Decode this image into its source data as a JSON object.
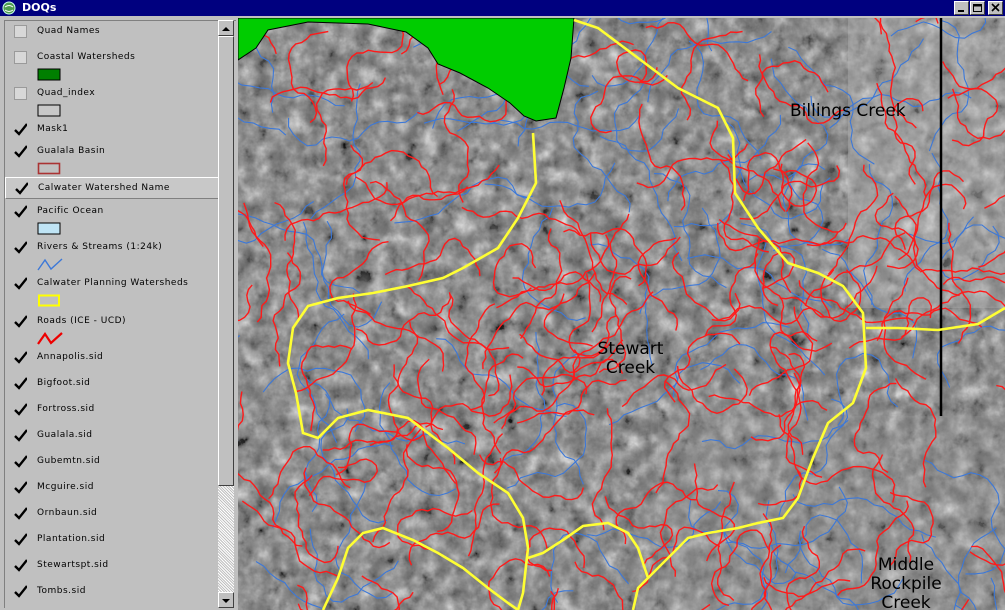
{
  "window": {
    "title": "DOQs"
  },
  "toc": {
    "layers": [
      {
        "label": "Quad Names",
        "checked": false,
        "symbol": null
      },
      {
        "label": "Coastal Watersheds",
        "checked": false,
        "symbol": "fill-green"
      },
      {
        "label": "Quad_index",
        "checked": false,
        "symbol": "fill-gray"
      },
      {
        "label": "Mask1",
        "checked": true,
        "symbol": null
      },
      {
        "label": "Gualala Basin",
        "checked": true,
        "symbol": "outline-brown"
      },
      {
        "label": "Calwater Watershed Name",
        "checked": true,
        "symbol": null,
        "selected": true
      },
      {
        "label": "Pacific Ocean",
        "checked": true,
        "symbol": "fill-lightblue"
      },
      {
        "label": "Rivers & Streams (1:24k)",
        "checked": true,
        "symbol": "line-blue"
      },
      {
        "label": "Calwater Planning Watersheds",
        "checked": true,
        "symbol": "outline-yellow"
      },
      {
        "label": "Roads (ICE - UCD)",
        "checked": true,
        "symbol": "line-red"
      },
      {
        "label": "Annapolis.sid",
        "checked": true,
        "symbol": null
      },
      {
        "label": "Bigfoot.sid",
        "checked": true,
        "symbol": null
      },
      {
        "label": "Fortross.sid",
        "checked": true,
        "symbol": null
      },
      {
        "label": "Gualala.sid",
        "checked": true,
        "symbol": null
      },
      {
        "label": "Gubemtn.sid",
        "checked": true,
        "symbol": null
      },
      {
        "label": "Mcguire.sid",
        "checked": true,
        "symbol": null
      },
      {
        "label": "Ornbaun.sid",
        "checked": true,
        "symbol": null
      },
      {
        "label": "Plantation.sid",
        "checked": true,
        "symbol": null
      },
      {
        "label": "Stewartspt.sid",
        "checked": true,
        "symbol": null
      },
      {
        "label": "Tombs.sid",
        "checked": true,
        "symbol": null
      }
    ]
  },
  "map": {
    "labels": {
      "billings": "Billings Creek",
      "stewart": "Stewart Creek",
      "rockpile": "Middle Rockpile Creek"
    }
  },
  "colors": {
    "titlebar": "#00007f",
    "watershed_fill": "#00cc00",
    "roads": "#ff0000",
    "streams": "#3c78d8",
    "planning_watersheds": "#ffff33"
  }
}
